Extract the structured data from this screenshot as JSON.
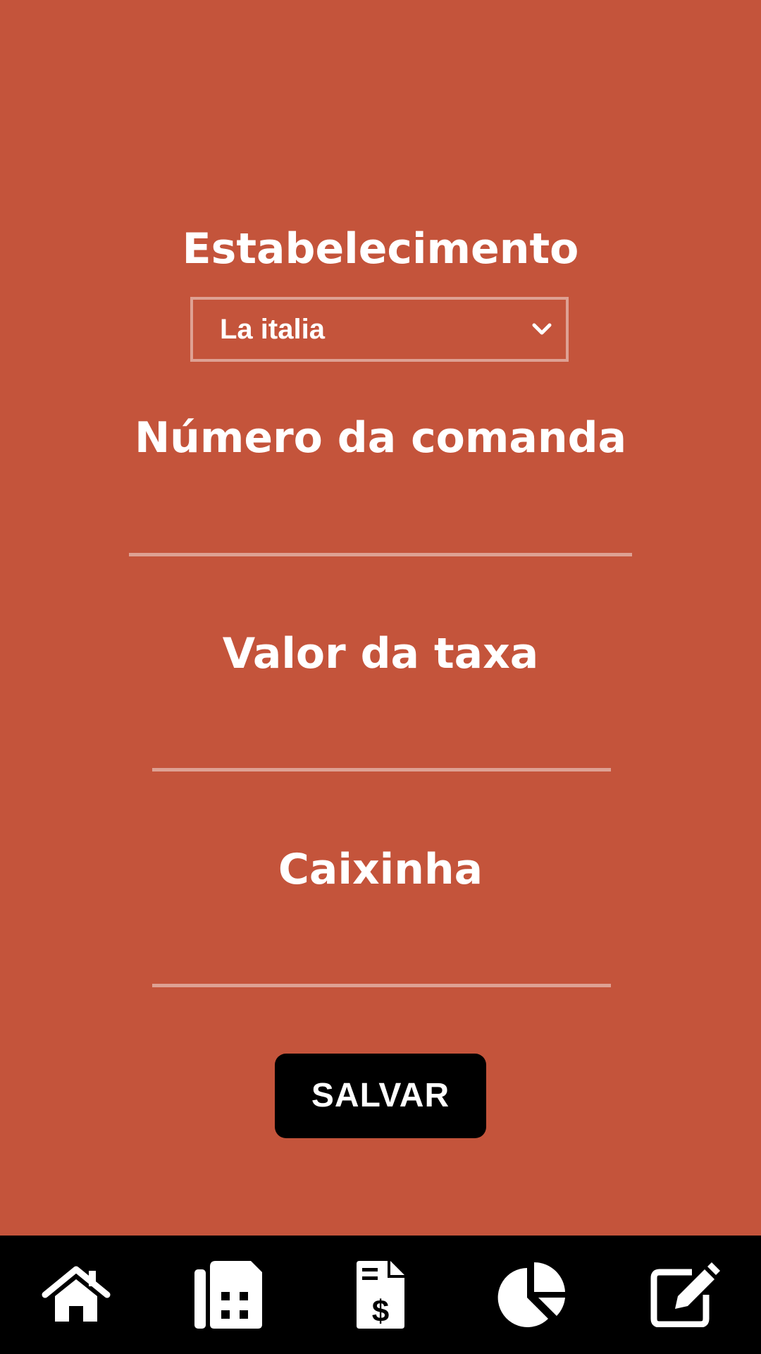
{
  "form": {
    "establishment_label": "Estabelecimento",
    "establishment_selected": "La italia",
    "order_number_label": "Número da comanda",
    "order_number_value": "",
    "fee_label": "Valor da taxa",
    "fee_value": "",
    "tip_label": "Caixinha",
    "tip_value": "",
    "save_label": "SALVAR"
  },
  "bottom_nav": {
    "items": [
      {
        "icon": "home-icon"
      },
      {
        "icon": "calculator-icon"
      },
      {
        "icon": "invoice-dollar-icon"
      },
      {
        "icon": "pie-chart-icon"
      },
      {
        "icon": "edit-icon"
      }
    ]
  },
  "colors": {
    "background": "#c4543b",
    "nav_background": "#000000",
    "button_background": "#000000",
    "text": "#ffffff"
  }
}
